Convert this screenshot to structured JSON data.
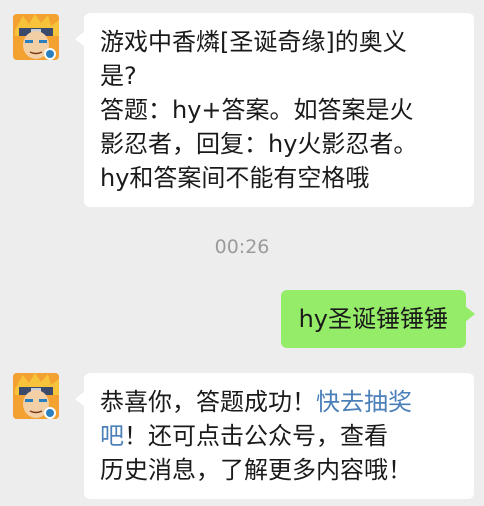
{
  "conversation": {
    "incoming_1": {
      "text": "游戏中香燐[圣诞奇缘]的奥义是?答题：hy+答案。如答案是火影忍者，回复：hy火影忍者。hy和答案间不能有空格哦",
      "lines": [
        "游戏中香燐[圣诞奇缘]的奥义",
        "是?",
        "答题：hy+答案。如答案是火",
        "影忍者，回复：hy火影忍者。",
        "hy和答案间不能有空格哦"
      ]
    },
    "timestamp": "00:26",
    "outgoing_1": {
      "text": "hy圣诞锤锤锤"
    },
    "incoming_2": {
      "text_before_link": "恭喜你，答题成功！",
      "link_text": "快去抽奖吧",
      "text_after_link": "！还可点击公众号，查看历史消息，了解更多内容哦！",
      "line1_plain": "恭喜你，答题成功！",
      "line1_link": "快去抽奖",
      "line2_link": "吧",
      "line2_plain": "！还可点击公众号，查看",
      "line3_plain": "历史消息，了解更多内容哦！"
    }
  },
  "colors": {
    "background": "#ededed",
    "incoming_bubble": "#ffffff",
    "outgoing_bubble": "#95ec69",
    "link": "#4a7fb8",
    "timestamp": "#9b9b9b"
  },
  "icons": {
    "avatar": "ninja-avatar-icon"
  }
}
